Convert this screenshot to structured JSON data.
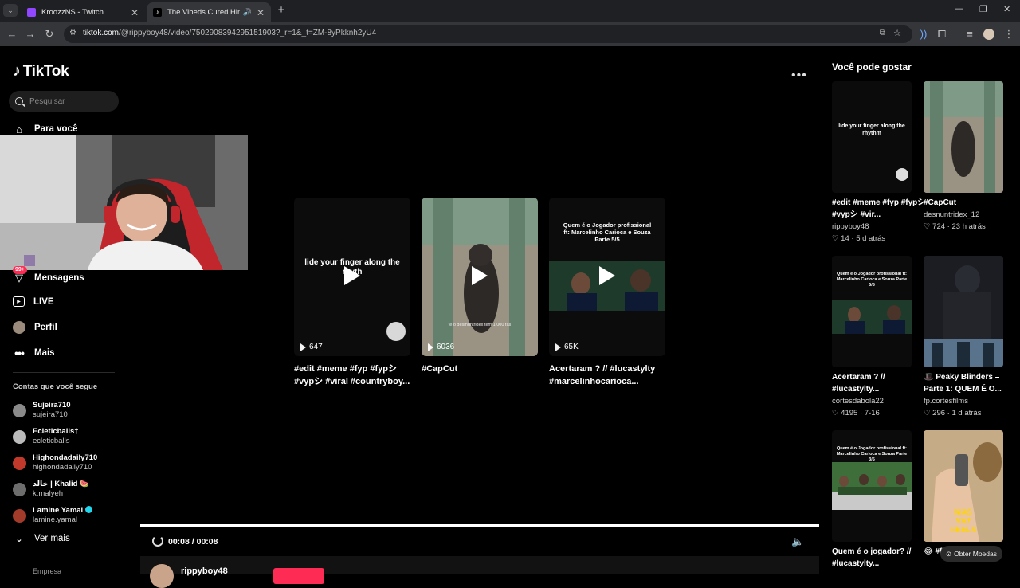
{
  "browser": {
    "tabs": [
      {
        "title": "KroozzNS - Twitch",
        "active": false,
        "favicon_color": "#9146ff"
      },
      {
        "title": "The Vibeds Cured Him: A H",
        "active": true,
        "favicon_color": "#ffffff"
      }
    ],
    "url_domain": "tiktok.com",
    "url_path": "/@rippyboy48/video/7502908394295151903?_r=1&_t=ZM-8yPkknh2yU4"
  },
  "sidebar": {
    "logo": "TikTok",
    "search_placeholder": "Pesquisar",
    "nav": [
      {
        "label": "Para você",
        "icon": "home-icon"
      },
      {
        "label": "Mensagens",
        "icon": "inbox-icon",
        "badge": "99+"
      },
      {
        "label": "LIVE",
        "icon": "live-icon"
      },
      {
        "label": "Perfil",
        "icon": "profile-icon"
      },
      {
        "label": "Mais",
        "icon": "more-icon"
      }
    ],
    "following_title": "Contas que você segue",
    "accounts": [
      {
        "name": "Sujeira710",
        "user": "sujeira710",
        "color": "#8a8a8a"
      },
      {
        "name": "Ecleticballs†",
        "user": "ecleticballs",
        "color": "#bbbbbb"
      },
      {
        "name": "Highondadaily710",
        "user": "highondadaily710",
        "color": "#c0392b"
      },
      {
        "name": "خالد | Khalid 🍉",
        "user": "k.malyeh",
        "color": "#6d6d6d"
      },
      {
        "name": "Lamine Yamal",
        "user": "lamine.yamal",
        "color": "#a33b2a"
      }
    ],
    "see_more": "Ver mais",
    "footer_label": "Empresa"
  },
  "player": {
    "cards": [
      {
        "views": "647",
        "caption": "#edit #meme #fyp #fypシ #vypシ #viral #countryboy...",
        "overlay": "lide your finger along the rhyth"
      },
      {
        "views": "6036",
        "caption": "#CapCut",
        "overlay": "te o desmuntridex tem 1.000 fãs"
      },
      {
        "views": "65K",
        "caption": "Acertaram ? // #lucastylty #marcelinhocarioca...",
        "overlay": "Quem é o Jogador profissional ft: Marcelinho Carioca e Souza Parte 5/5"
      }
    ],
    "time": "00:08 / 00:08",
    "progress": 1.0,
    "author": "rippyboy48"
  },
  "recommendations": {
    "title": "Você pode gostar",
    "items": [
      {
        "caption": "#edit #meme #fyp #fypシ #vypシ #vir...",
        "author": "rippyboy48",
        "likes": "14",
        "age": "5 d atrás",
        "overlay": "lide your finger along the rhythm"
      },
      {
        "caption": "#CapCut",
        "author": "desnuntridex_12",
        "likes": "724",
        "age": "23 h atrás",
        "overlay": ""
      },
      {
        "caption": "Acertaram ? // #lucastylty...",
        "author": "cortesdabola22",
        "likes": "4195",
        "age": "7-16",
        "overlay": "Quem é o Jogador profissional ft: Marcelinho Carioca e Souza Parte 5/5"
      },
      {
        "caption": "🎩 Peaky Blinders – Parte 1: QUEM É O...",
        "author": "fp.cortesfilms",
        "likes": "296",
        "age": "1 d atrás",
        "overlay": ""
      },
      {
        "caption": "Quem é o jogador? // #lucastylty...",
        "author": "",
        "likes": "",
        "age": "",
        "overlay": "Quem é o Jogador profissional ft: Marcelinho Carioca e Souza Parte 3/5"
      },
      {
        "caption": "😂 #fyp #engraçado",
        "author": "",
        "likes": "",
        "age": "",
        "overlay": "MAS VA7 REELS"
      }
    ],
    "coins_label": "Obter Moedas"
  },
  "colors": {
    "accent": "#fe2c55",
    "badge": "#fe2c55",
    "verified": "#20d5ec"
  }
}
